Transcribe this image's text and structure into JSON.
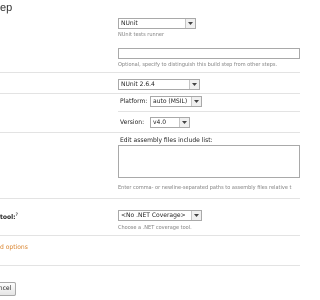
{
  "page": {
    "title": "ep"
  },
  "runner": {
    "value": "NUnit",
    "hint": "NUnit tests runner"
  },
  "step_name": {
    "value": "",
    "hint": "Optional, specify to distinguish this build step from other steps."
  },
  "nunit_version": {
    "value": "NUnit 2.6.4"
  },
  "platform": {
    "label": "Platform:",
    "value": "auto (MSIL)"
  },
  "version": {
    "label": "Version:",
    "value": "v4.0"
  },
  "assemblies": {
    "label": "Edit assembly files include list:",
    "value": "",
    "hint": "Enter comma- or newline-separated paths to assembly files relative t"
  },
  "coverage": {
    "row_label": "tool:",
    "help_mark": "?",
    "value": "<No .NET Coverage>",
    "hint": "Choose a .NET coverage tool."
  },
  "advanced_link": "d options",
  "cancel_button": "ncel",
  "colors": {
    "link": "#d9822b",
    "hint": "#808080",
    "border": "#a9a9a9"
  }
}
